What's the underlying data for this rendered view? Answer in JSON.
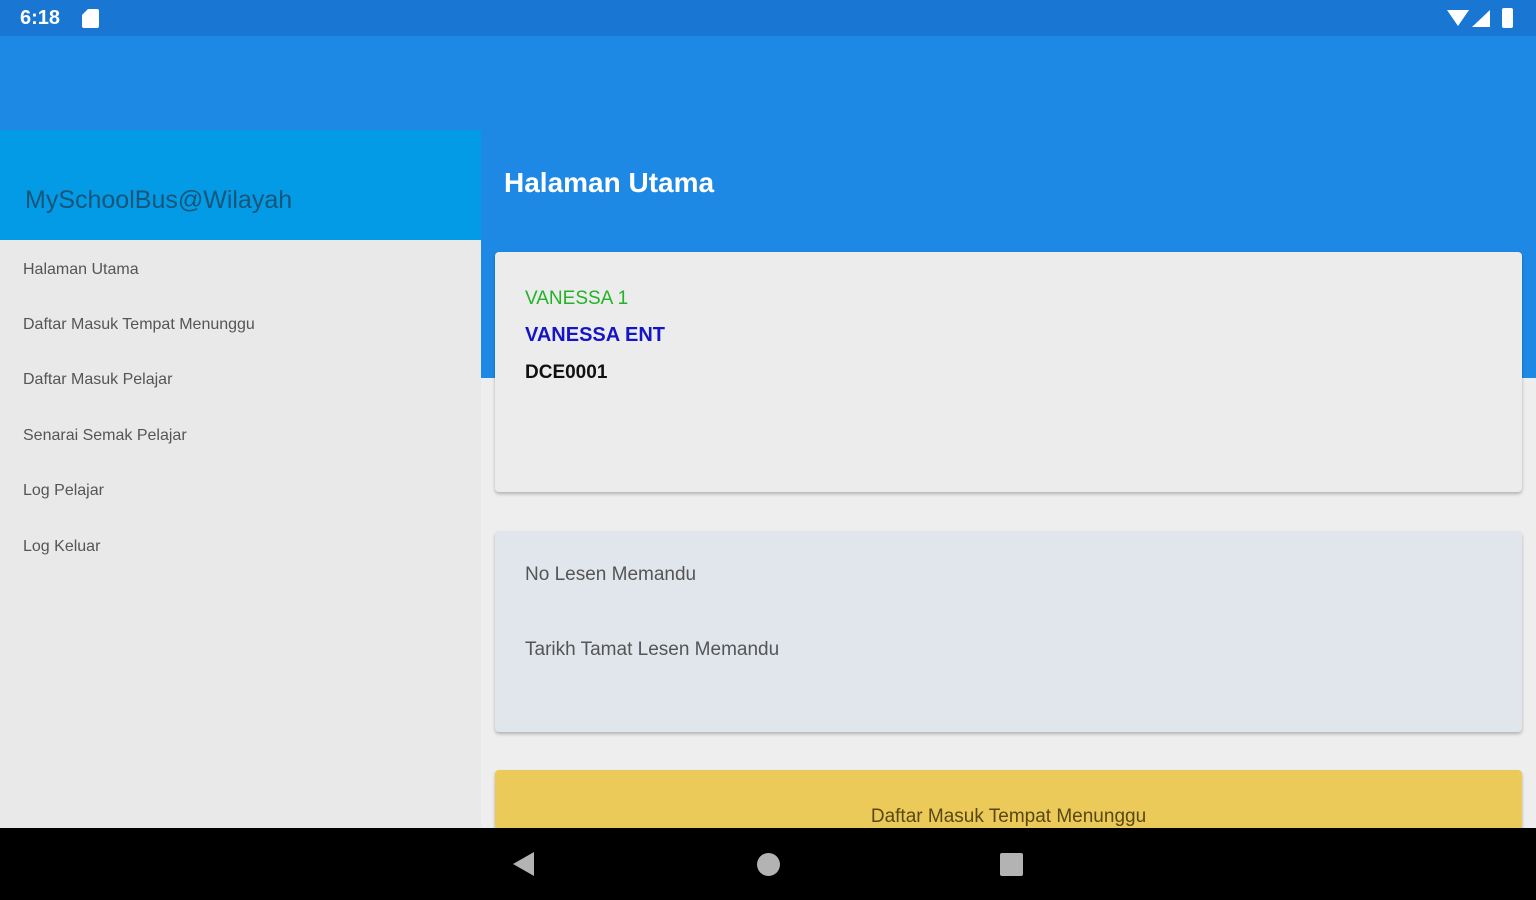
{
  "status_bar": {
    "time": "6:18",
    "icons": [
      "sd-card-icon",
      "wifi-icon",
      "signal-icon",
      "battery-icon"
    ]
  },
  "drawer": {
    "title": "MySchoolBus@Wilayah",
    "items": [
      {
        "label": "Halaman Utama"
      },
      {
        "label": "Daftar Masuk Tempat Menunggu"
      },
      {
        "label": "Daftar Masuk Pelajar"
      },
      {
        "label": "Senarai Semak Pelajar"
      },
      {
        "label": "Log Pelajar"
      },
      {
        "label": "Log Keluar"
      }
    ]
  },
  "main": {
    "title": "Halaman Utama",
    "vehicle_card": {
      "name": "VANESSA 1",
      "company": "VANESSA ENT",
      "code": "DCE0001"
    },
    "license_card": {
      "license_no_label": "No Lesen Memandu",
      "license_expiry_label": "Tarikh Tamat Lesen Memandu"
    },
    "action_card": {
      "label": "Daftar Masuk Tempat Menunggu"
    }
  },
  "colors": {
    "status_bar": "#1976d2",
    "app_bar": "#1e88e5",
    "drawer_header": "#039be5",
    "vehicle_name": "#22b327",
    "company_name": "#1515c8",
    "action_card": "#ecca5a"
  },
  "nav_bar": {
    "icons": [
      "back-icon",
      "home-icon",
      "recents-icon"
    ]
  }
}
